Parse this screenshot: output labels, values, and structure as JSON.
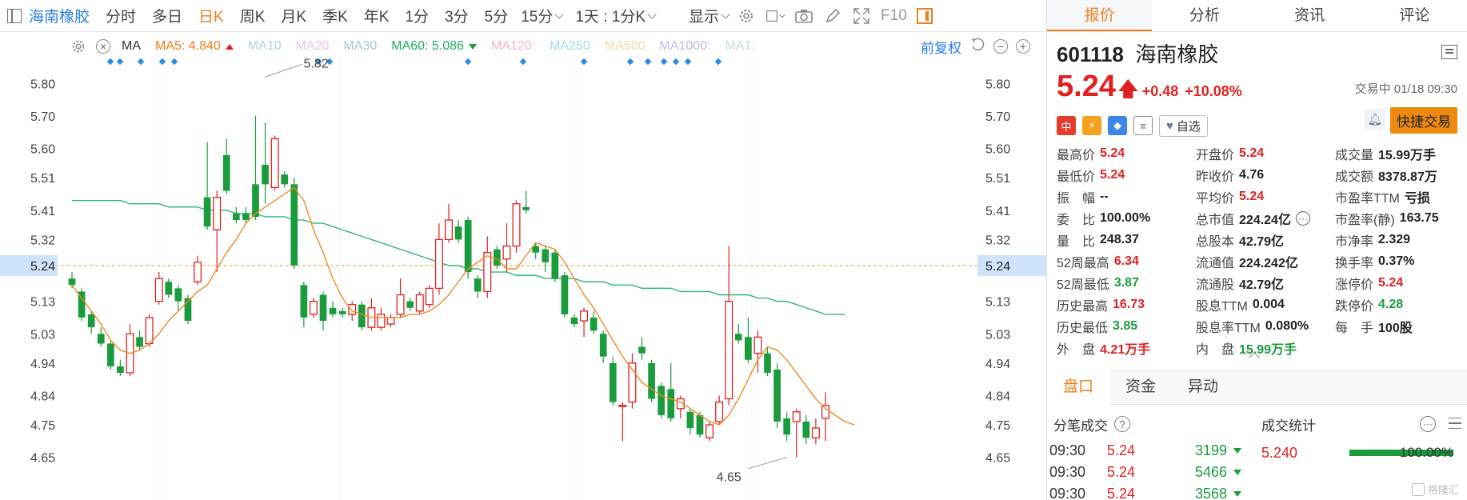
{
  "toolbar": {
    "stock_name": "海南橡胶",
    "periods": [
      "分时",
      "多日",
      "日K",
      "周K",
      "月K",
      "季K",
      "年K",
      "1分",
      "3分",
      "5分"
    ],
    "active_period": "日K",
    "period_select": "15分",
    "interval_select": "1天 : 1分K",
    "display_label": "显示",
    "f10_label": "F10"
  },
  "ma_bar": {
    "label": "MA",
    "items": [
      {
        "text": "MA5: 4.840",
        "color": "#ef7e1b",
        "arrow": "up"
      },
      {
        "text": "MA10",
        "color": "#a9cfee"
      },
      {
        "text": "MA20",
        "color": "#e9c3ea"
      },
      {
        "text": "MA30",
        "color": "#a9c3e3"
      },
      {
        "text": "MA60: 5.086",
        "color": "#1fae5c",
        "arrow": "down"
      },
      {
        "text": "MA120:",
        "color": "#f3b6c2"
      },
      {
        "text": "MA250",
        "color": "#9fd8f0"
      },
      {
        "text": "MA500",
        "color": "#f3dba8"
      },
      {
        "text": "MA1000:",
        "color": "#c9b7ea"
      },
      {
        "text": "MA1:",
        "color": "#c9d6e6"
      }
    ],
    "adjust_label": "前复权"
  },
  "chart_data": {
    "type": "candlestick",
    "y_ticks": [
      5.8,
      5.7,
      5.6,
      5.51,
      5.41,
      5.32,
      5.24,
      5.13,
      5.03,
      4.94,
      4.84,
      4.75,
      4.65
    ],
    "ylim": [
      4.6,
      5.86
    ],
    "current_price_label": "5.24",
    "reference_price": 5.24,
    "annotations": [
      {
        "label": "5.82",
        "value": 5.82,
        "index": 20
      },
      {
        "label": "4.65",
        "value": 4.65,
        "index": 74
      }
    ],
    "up_color": "#e02020",
    "down_color": "#1a9b3c",
    "candles": [
      [
        5.2,
        5.18,
        5.22,
        5.17
      ],
      [
        5.16,
        5.08,
        5.17,
        5.07
      ],
      [
        5.09,
        5.05,
        5.1,
        5.03
      ],
      [
        5.03,
        5.0,
        5.05,
        4.99
      ],
      [
        5.0,
        4.93,
        5.01,
        4.92
      ],
      [
        4.93,
        4.91,
        4.95,
        4.9
      ],
      [
        4.91,
        5.03,
        5.06,
        4.9
      ],
      [
        5.02,
        4.99,
        5.04,
        4.98
      ],
      [
        5.0,
        5.08,
        5.09,
        4.99
      ],
      [
        5.13,
        5.2,
        5.22,
        5.12
      ],
      [
        5.19,
        5.15,
        5.2,
        5.14
      ],
      [
        5.17,
        5.13,
        5.18,
        5.1
      ],
      [
        5.14,
        5.07,
        5.15,
        5.06
      ],
      [
        5.19,
        5.25,
        5.27,
        5.18
      ],
      [
        5.45,
        5.36,
        5.62,
        5.35
      ],
      [
        5.35,
        5.45,
        5.47,
        5.22
      ],
      [
        5.58,
        5.47,
        5.63,
        5.46
      ],
      [
        5.4,
        5.38,
        5.42,
        5.37
      ],
      [
        5.4,
        5.38,
        5.42,
        5.37
      ],
      [
        5.49,
        5.39,
        5.7,
        5.38
      ],
      [
        5.55,
        5.49,
        5.68,
        5.43
      ],
      [
        5.48,
        5.63,
        5.64,
        5.47
      ],
      [
        5.52,
        5.49,
        5.53,
        5.48
      ],
      [
        5.49,
        5.24,
        5.51,
        5.23
      ],
      [
        5.18,
        5.08,
        5.19,
        5.05
      ],
      [
        5.09,
        5.13,
        5.14,
        5.08
      ],
      [
        5.15,
        5.07,
        5.16,
        5.04
      ],
      [
        5.11,
        5.09,
        5.13,
        5.08
      ],
      [
        5.1,
        5.09,
        5.11,
        5.08
      ],
      [
        5.09,
        5.12,
        5.13,
        5.07
      ],
      [
        5.12,
        5.05,
        5.13,
        5.04
      ],
      [
        5.05,
        5.11,
        5.14,
        5.04
      ],
      [
        5.05,
        5.09,
        5.11,
        5.04
      ],
      [
        5.06,
        5.08,
        5.09,
        5.05
      ],
      [
        5.09,
        5.15,
        5.2,
        5.08
      ],
      [
        5.13,
        5.11,
        5.14,
        5.1
      ],
      [
        5.1,
        5.15,
        5.16,
        5.09
      ],
      [
        5.12,
        5.17,
        5.18,
        5.11
      ],
      [
        5.17,
        5.32,
        5.37,
        5.15
      ],
      [
        5.32,
        5.38,
        5.43,
        5.31
      ],
      [
        5.36,
        5.32,
        5.38,
        5.31
      ],
      [
        5.38,
        5.22,
        5.39,
        5.2
      ],
      [
        5.2,
        5.16,
        5.21,
        5.14
      ],
      [
        5.16,
        5.28,
        5.33,
        5.14
      ],
      [
        5.29,
        5.24,
        5.3,
        5.23
      ],
      [
        5.26,
        5.3,
        5.37,
        5.22
      ],
      [
        5.3,
        5.43,
        5.44,
        5.28
      ],
      [
        5.42,
        5.41,
        5.47,
        5.4
      ],
      [
        5.3,
        5.28,
        5.31,
        5.26
      ],
      [
        5.29,
        5.25,
        5.3,
        5.22
      ],
      [
        5.28,
        5.2,
        5.29,
        5.19
      ],
      [
        5.21,
        5.09,
        5.22,
        5.08
      ],
      [
        5.08,
        5.06,
        5.09,
        5.05
      ],
      [
        5.07,
        5.1,
        5.11,
        5.02
      ],
      [
        5.08,
        5.04,
        5.1,
        5.03
      ],
      [
        5.03,
        4.96,
        5.04,
        4.94
      ],
      [
        4.94,
        4.82,
        4.96,
        4.81
      ],
      [
        4.81,
        4.81,
        4.82,
        4.7
      ],
      [
        4.82,
        4.94,
        4.97,
        4.8
      ],
      [
        4.99,
        4.97,
        5.02,
        4.95
      ],
      [
        4.94,
        4.83,
        4.95,
        4.82
      ],
      [
        4.87,
        4.78,
        4.88,
        4.77
      ],
      [
        4.86,
        4.77,
        4.94,
        4.76
      ],
      [
        4.8,
        4.83,
        4.84,
        4.77
      ],
      [
        4.79,
        4.74,
        4.8,
        4.72
      ],
      [
        4.78,
        4.72,
        4.79,
        4.71
      ],
      [
        4.71,
        4.75,
        4.76,
        4.7
      ],
      [
        4.76,
        4.82,
        4.84,
        4.75
      ],
      [
        4.83,
        5.13,
        5.3,
        4.81
      ],
      [
        5.03,
        5.01,
        5.06,
        5.0
      ],
      [
        5.02,
        4.95,
        5.08,
        4.94
      ],
      [
        4.97,
        5.02,
        5.04,
        4.91
      ],
      [
        4.97,
        4.91,
        4.99,
        4.9
      ],
      [
        4.92,
        4.76,
        4.94,
        4.74
      ],
      [
        4.77,
        4.72,
        4.79,
        4.7
      ],
      [
        4.76,
        4.79,
        4.8,
        4.65
      ],
      [
        4.76,
        4.71,
        4.78,
        4.69
      ],
      [
        4.71,
        4.74,
        4.77,
        4.69
      ],
      [
        4.77,
        4.81,
        4.85,
        4.7
      ]
    ],
    "ma5": [
      5.18,
      5.14,
      5.1,
      5.06,
      5.01,
      4.98,
      4.97,
      4.98,
      5.0,
      5.03,
      5.07,
      5.1,
      5.13,
      5.16,
      5.18,
      5.23,
      5.28,
      5.32,
      5.37,
      5.4,
      5.42,
      5.44,
      5.46,
      5.48,
      5.44,
      5.35,
      5.28,
      5.2,
      5.14,
      5.1,
      5.09,
      5.08,
      5.08,
      5.08,
      5.08,
      5.09,
      5.09,
      5.1,
      5.12,
      5.15,
      5.19,
      5.23,
      5.25,
      5.27,
      5.26,
      5.23,
      5.23,
      5.27,
      5.31,
      5.3,
      5.29,
      5.25,
      5.2,
      5.15,
      5.11,
      5.06,
      5.01,
      4.96,
      4.92,
      4.88,
      4.86,
      4.84,
      4.83,
      4.82,
      4.8,
      4.78,
      4.76,
      4.75,
      4.78,
      4.83,
      4.89,
      4.95,
      4.99,
      4.98,
      4.95,
      4.91,
      4.87,
      4.83,
      4.8,
      4.78,
      4.76,
      4.75
    ],
    "ma60": [
      5.44,
      5.44,
      5.44,
      5.44,
      5.44,
      5.44,
      5.43,
      5.43,
      5.43,
      5.43,
      5.42,
      5.42,
      5.42,
      5.42,
      5.41,
      5.41,
      5.41,
      5.4,
      5.4,
      5.4,
      5.39,
      5.39,
      5.39,
      5.38,
      5.38,
      5.37,
      5.37,
      5.36,
      5.35,
      5.34,
      5.33,
      5.32,
      5.31,
      5.3,
      5.29,
      5.28,
      5.27,
      5.26,
      5.25,
      5.24,
      5.24,
      5.23,
      5.23,
      5.22,
      5.22,
      5.22,
      5.21,
      5.21,
      5.21,
      5.2,
      5.2,
      5.2,
      5.2,
      5.19,
      5.19,
      5.19,
      5.18,
      5.18,
      5.18,
      5.17,
      5.17,
      5.17,
      5.17,
      5.16,
      5.16,
      5.16,
      5.16,
      5.15,
      5.15,
      5.15,
      5.15,
      5.14,
      5.14,
      5.13,
      5.13,
      5.12,
      5.11,
      5.1,
      5.09,
      5.09,
      5.09
    ]
  },
  "quote": {
    "tabs": [
      "报价",
      "分析",
      "资讯",
      "评论"
    ],
    "code": "601118",
    "name": "海南橡胶",
    "price": "5.24",
    "change": "+0.48",
    "change_pct": "+10.08%",
    "status": "交易中 01/18 09:30",
    "badge_cn": "中",
    "watch_label": "自选",
    "trade_button": "快捷交易",
    "fields": [
      {
        "k": "最高价",
        "v": "5.24",
        "c": "red"
      },
      {
        "k": "开盘价",
        "v": "5.24",
        "c": "red"
      },
      {
        "k": "成交量",
        "v": "15.99万手",
        "c": "black"
      },
      {
        "k": "最低价",
        "v": "5.24",
        "c": "red"
      },
      {
        "k": "昨收价",
        "v": "4.76",
        "c": "black"
      },
      {
        "k": "成交额",
        "v": "8378.87万",
        "c": "black"
      },
      {
        "k": "振　幅",
        "v": "--",
        "c": "black"
      },
      {
        "k": "平均价",
        "v": "5.24",
        "c": "red"
      },
      {
        "k": "市盈率TTM",
        "v": "亏损",
        "c": "black"
      },
      {
        "k": "委　比",
        "v": "100.00%",
        "c": "black"
      },
      {
        "k": "总市值",
        "v": "224.24亿",
        "c": "black",
        "more": true
      },
      {
        "k": "市盈率(静)",
        "v": "163.75",
        "c": "black"
      },
      {
        "k": "量　比",
        "v": "248.37",
        "c": "black"
      },
      {
        "k": "总股本",
        "v": "42.79亿",
        "c": "black"
      },
      {
        "k": "市净率",
        "v": "2.329",
        "c": "black"
      },
      {
        "k": "52周最高",
        "v": "6.34",
        "c": "red"
      },
      {
        "k": "流通值",
        "v": "224.242亿",
        "c": "black"
      },
      {
        "k": "换手率",
        "v": "0.37%",
        "c": "black"
      },
      {
        "k": "52周最低",
        "v": "3.87",
        "c": "green"
      },
      {
        "k": "流通股",
        "v": "42.79亿",
        "c": "black"
      },
      {
        "k": "涨停价",
        "v": "5.24",
        "c": "red"
      },
      {
        "k": "历史最高",
        "v": "16.73",
        "c": "red"
      },
      {
        "k": "股息TTM",
        "v": "0.004",
        "c": "black"
      },
      {
        "k": "跌停价",
        "v": "4.28",
        "c": "green"
      },
      {
        "k": "历史最低",
        "v": "3.85",
        "c": "green"
      },
      {
        "k": "股息率TTM",
        "v": "0.080%",
        "c": "black"
      },
      {
        "k": "每　手",
        "v": "100股",
        "c": "black"
      },
      {
        "k": "外　盘",
        "v": "4.21万手",
        "c": "red"
      },
      {
        "k": "内　盘",
        "v": "15.99万手",
        "c": "green"
      },
      {
        "k": "",
        "v": "",
        "c": "black"
      }
    ],
    "subtabs": [
      "盘口",
      "资金",
      "异动"
    ],
    "ticks_title": "分笔成交",
    "ticks": [
      {
        "time": "09:30",
        "price": "5.24",
        "vol": "3199"
      },
      {
        "time": "09:30",
        "price": "5.24",
        "vol": "5466"
      },
      {
        "time": "09:30",
        "price": "5.24",
        "vol": "3568"
      }
    ],
    "stats_title": "成交统计",
    "stats": [
      {
        "price": "5.240",
        "pct": "100.00%",
        "fill": 1.0
      }
    ],
    "watermark": "格隆汇"
  }
}
